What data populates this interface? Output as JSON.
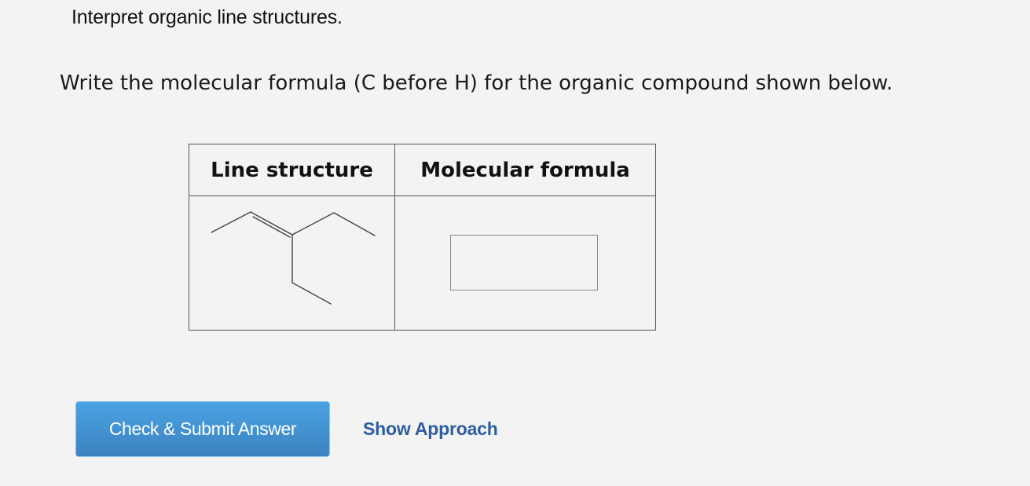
{
  "title": "Interpret organic line structures.",
  "question": "Write the molecular formula (C before H) for the organic compound shown below.",
  "table": {
    "col1_header": "Line structure",
    "col2_header": "Molecular formula"
  },
  "formula_input": {
    "value": "",
    "placeholder": ""
  },
  "buttons": {
    "submit_label": "Check & Submit Answer",
    "approach_label": "Show Approach"
  },
  "colors": {
    "background": "#f3f3f3",
    "button_top": "#4aa3e3",
    "button_bottom": "#3d82c0",
    "link": "#2e5e9e"
  },
  "icons": {
    "structure": "skeletal-line-structure-3-methylpent-2-ene"
  }
}
